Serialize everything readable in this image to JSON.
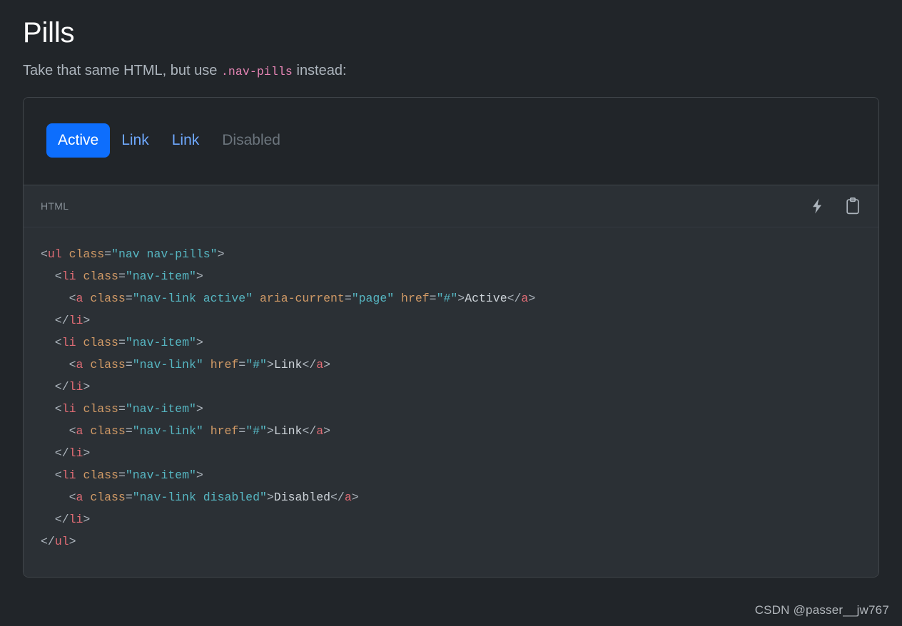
{
  "heading": {
    "title": "Pills",
    "subtitle_before": "Take that same HTML, but use ",
    "subtitle_code": ".nav-pills",
    "subtitle_after": " instead:"
  },
  "example": {
    "pills": [
      {
        "label": "Active",
        "state": "active"
      },
      {
        "label": "Link",
        "state": "default"
      },
      {
        "label": "Link",
        "state": "default"
      },
      {
        "label": "Disabled",
        "state": "disabled"
      }
    ]
  },
  "toolbar": {
    "language": "HTML",
    "lightning_icon": "lightning-bolt-icon",
    "copy_icon": "clipboard-icon"
  },
  "code": {
    "language": "html",
    "lines": [
      "<ul class=\"nav nav-pills\">",
      "  <li class=\"nav-item\">",
      "    <a class=\"nav-link active\" aria-current=\"page\" href=\"#\">Active</a>",
      "  </li>",
      "  <li class=\"nav-item\">",
      "    <a class=\"nav-link\" href=\"#\">Link</a>",
      "  </li>",
      "  <li class=\"nav-item\">",
      "    <a class=\"nav-link\" href=\"#\">Link</a>",
      "  </li>",
      "  <li class=\"nav-item\">",
      "    <a class=\"nav-link disabled\">Disabled</a>",
      "  </li>",
      "</ul>"
    ],
    "tokens": [
      [
        [
          "p",
          "<"
        ],
        [
          "nt",
          "ul"
        ],
        [
          "p",
          " "
        ],
        [
          "na",
          "class"
        ],
        [
          "p",
          "="
        ],
        [
          "s",
          "\"nav nav-pills\""
        ],
        [
          "p",
          ">"
        ]
      ],
      [
        [
          "p",
          "  <"
        ],
        [
          "nt",
          "li"
        ],
        [
          "p",
          " "
        ],
        [
          "na",
          "class"
        ],
        [
          "p",
          "="
        ],
        [
          "s",
          "\"nav-item\""
        ],
        [
          "p",
          ">"
        ]
      ],
      [
        [
          "p",
          "    <"
        ],
        [
          "nt",
          "a"
        ],
        [
          "p",
          " "
        ],
        [
          "na",
          "class"
        ],
        [
          "p",
          "="
        ],
        [
          "s",
          "\"nav-link active\""
        ],
        [
          "p",
          " "
        ],
        [
          "na",
          "aria-current"
        ],
        [
          "p",
          "="
        ],
        [
          "s",
          "\"page\""
        ],
        [
          "p",
          " "
        ],
        [
          "na",
          "href"
        ],
        [
          "p",
          "="
        ],
        [
          "s",
          "\"#\""
        ],
        [
          "p",
          ">"
        ],
        [
          "tx",
          "Active"
        ],
        [
          "p",
          "</"
        ],
        [
          "nt",
          "a"
        ],
        [
          "p",
          ">"
        ]
      ],
      [
        [
          "p",
          "  </"
        ],
        [
          "nt",
          "li"
        ],
        [
          "p",
          ">"
        ]
      ],
      [
        [
          "p",
          "  <"
        ],
        [
          "nt",
          "li"
        ],
        [
          "p",
          " "
        ],
        [
          "na",
          "class"
        ],
        [
          "p",
          "="
        ],
        [
          "s",
          "\"nav-item\""
        ],
        [
          "p",
          ">"
        ]
      ],
      [
        [
          "p",
          "    <"
        ],
        [
          "nt",
          "a"
        ],
        [
          "p",
          " "
        ],
        [
          "na",
          "class"
        ],
        [
          "p",
          "="
        ],
        [
          "s",
          "\"nav-link\""
        ],
        [
          "p",
          " "
        ],
        [
          "na",
          "href"
        ],
        [
          "p",
          "="
        ],
        [
          "s",
          "\"#\""
        ],
        [
          "p",
          ">"
        ],
        [
          "tx",
          "Link"
        ],
        [
          "p",
          "</"
        ],
        [
          "nt",
          "a"
        ],
        [
          "p",
          ">"
        ]
      ],
      [
        [
          "p",
          "  </"
        ],
        [
          "nt",
          "li"
        ],
        [
          "p",
          ">"
        ]
      ],
      [
        [
          "p",
          "  <"
        ],
        [
          "nt",
          "li"
        ],
        [
          "p",
          " "
        ],
        [
          "na",
          "class"
        ],
        [
          "p",
          "="
        ],
        [
          "s",
          "\"nav-item\""
        ],
        [
          "p",
          ">"
        ]
      ],
      [
        [
          "p",
          "    <"
        ],
        [
          "nt",
          "a"
        ],
        [
          "p",
          " "
        ],
        [
          "na",
          "class"
        ],
        [
          "p",
          "="
        ],
        [
          "s",
          "\"nav-link\""
        ],
        [
          "p",
          " "
        ],
        [
          "na",
          "href"
        ],
        [
          "p",
          "="
        ],
        [
          "s",
          "\"#\""
        ],
        [
          "p",
          ">"
        ],
        [
          "tx",
          "Link"
        ],
        [
          "p",
          "</"
        ],
        [
          "nt",
          "a"
        ],
        [
          "p",
          ">"
        ]
      ],
      [
        [
          "p",
          "  </"
        ],
        [
          "nt",
          "li"
        ],
        [
          "p",
          ">"
        ]
      ],
      [
        [
          "p",
          "  <"
        ],
        [
          "nt",
          "li"
        ],
        [
          "p",
          " "
        ],
        [
          "na",
          "class"
        ],
        [
          "p",
          "="
        ],
        [
          "s",
          "\"nav-item\""
        ],
        [
          "p",
          ">"
        ]
      ],
      [
        [
          "p",
          "    <"
        ],
        [
          "nt",
          "a"
        ],
        [
          "p",
          " "
        ],
        [
          "na",
          "class"
        ],
        [
          "p",
          "="
        ],
        [
          "s",
          "\"nav-link disabled\""
        ],
        [
          "p",
          ">"
        ],
        [
          "tx",
          "Disabled"
        ],
        [
          "p",
          "</"
        ],
        [
          "nt",
          "a"
        ],
        [
          "p",
          ">"
        ]
      ],
      [
        [
          "p",
          "  </"
        ],
        [
          "nt",
          "li"
        ],
        [
          "p",
          ">"
        ]
      ],
      [
        [
          "p",
          "</"
        ],
        [
          "nt",
          "ul"
        ],
        [
          "p",
          ">"
        ]
      ]
    ]
  },
  "watermark": {
    "text": "CSDN @passer__jw767"
  },
  "colors": {
    "page_bg": "#212529",
    "code_bg": "#2b3035",
    "border": "#41464b",
    "active_pill": "#0d6efd",
    "link": "#6ea8fe",
    "disabled": "#6c757d",
    "inline_code": "#e685b5",
    "tag": "#e06c75",
    "attr": "#d19a66",
    "string": "#56b6c2"
  }
}
